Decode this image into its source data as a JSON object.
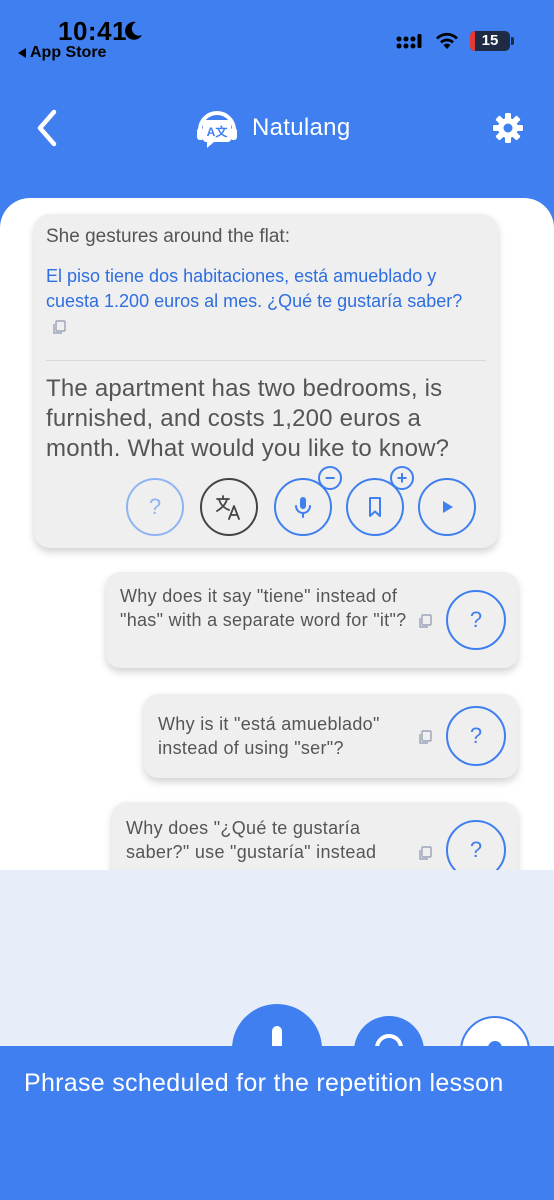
{
  "status_bar": {
    "time": "10:41",
    "back_to": "App Store",
    "battery": "15"
  },
  "header": {
    "title": "Natulang"
  },
  "message": {
    "intro": "She gestures around the flat:",
    "spanish": "El piso tiene dos habitaciones, está amueblado y cuesta 1.200 euros al mes. ¿Qué te gustaría saber?",
    "english": "The apartment has two bedrooms, is furnished, and costs 1,200 euros a month. What would you like to know?",
    "question_symbol": "?"
  },
  "questions": [
    {
      "text": "Why does it say \"tiene\" instead of \"has\" with a separate word for \"it\"?",
      "button": "?"
    },
    {
      "text": "Why is it \"está amueblado\" instead of using \"ser\"?",
      "button": "?"
    },
    {
      "text": "Why does \"¿Qué te gustaría saber?\" use \"gustaría\" instead",
      "button": "?"
    }
  ],
  "toast": {
    "message": "Phrase scheduled for the repetition lesson"
  },
  "colors": {
    "primary": "#3f7ff0",
    "spanish_text": "#2e6ee0",
    "card_bg": "#efefef"
  }
}
